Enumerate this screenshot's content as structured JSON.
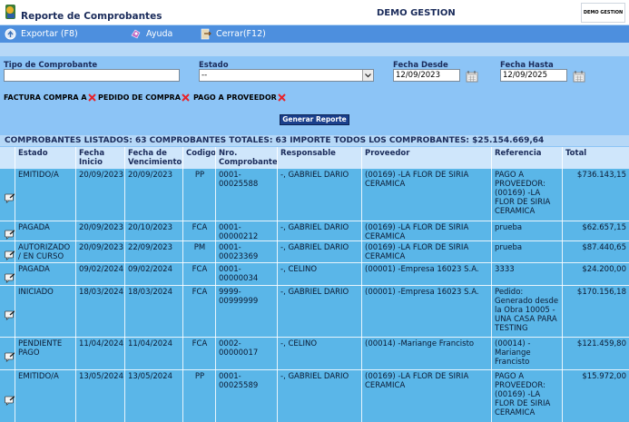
{
  "header": {
    "title": "Reporte de Comprobantes",
    "company": "DEMO GESTION",
    "company_logo_text": "DEMO GESTION"
  },
  "toolbar": {
    "export_label": "Exportar (F8)",
    "help_label": "Ayuda",
    "close_label": "Cerrar(F12)"
  },
  "filters": {
    "tipo_label": "Tipo de Comprobante",
    "tipo_value": "",
    "estado_label": "Estado",
    "estado_value": "--",
    "fecha_desde_label": "Fecha Desde",
    "fecha_desde_value": "12/09/2023",
    "fecha_hasta_label": "Fecha Hasta",
    "fecha_hasta_value": "12/09/2025",
    "chips": [
      "FACTURA COMPRA A",
      "PEDIDO DE COMPRA",
      "PAGO A PROVEEDOR"
    ],
    "generate_label": "Generar Reporte"
  },
  "summary": "COMPROBANTES LISTADOS: 63 COMPROBANTES TOTALES: 63 IMPORTE TODOS LOS COMPROBANTES: $25.154.669,64",
  "table": {
    "headers": [
      "Estado",
      "Fecha Inicio",
      "Fecha de Vencimiento",
      "Codigo",
      "Nro. Comprobante",
      "Responsable",
      "Proveedor",
      "Referencia",
      "Total"
    ],
    "rows": [
      [
        "EMITIDO/A",
        "20/09/2023",
        "20/09/2023",
        "PP",
        "0001-00025588",
        "-, GABRIEL DARIO",
        "(00169) -LA FLOR DE SIRIA CERAMICA",
        "PAGO A PROVEEDOR: (00169) -LA FLOR DE SIRIA CERAMICA",
        "$736.143,15"
      ],
      [
        "PAGADA",
        "20/09/2023",
        "20/10/2023",
        "FCA",
        "0001-00000212",
        "-, GABRIEL DARIO",
        "(00169) -LA FLOR DE SIRIA CERAMICA",
        "prueba",
        "$62.657,15"
      ],
      [
        "AUTORIZADO / EN CURSO",
        "20/09/2023",
        "22/09/2023",
        "PM",
        "0001-00023369",
        "-, GABRIEL DARIO",
        "(00169) -LA FLOR DE SIRIA CERAMICA",
        "prueba",
        "$87.440,65"
      ],
      [
        "PAGADA",
        "09/02/2024",
        "09/02/2024",
        "FCA",
        "0001-00000034",
        "-, CELINO",
        "(00001) -Empresa 16023 S.A.",
        "3333",
        "$24.200,00"
      ],
      [
        "INICIADO",
        "18/03/2024",
        "18/03/2024",
        "FCA",
        "9999-00999999",
        "-, GABRIEL DARIO",
        "(00001) -Empresa 16023 S.A.",
        "Pedido: Generado desde la Obra 10005 - UNA CASA PARA TESTING",
        "$170.156,18"
      ],
      [
        "PENDIENTE PAGO",
        "11/04/2024",
        "11/04/2024",
        "FCA",
        "0002-00000017",
        "-, CELINO",
        "(00014) -Mariange Francisto",
        "(00014) -Mariange Francisto",
        "$121.459,80"
      ],
      [
        "EMITIDO/A",
        "13/05/2024",
        "13/05/2024",
        "PP",
        "0001-00025589",
        "-, GABRIEL DARIO",
        "(00169) -LA FLOR DE SIRIA CERAMICA",
        "PAGO A PROVEEDOR: (00169) -LA FLOR DE SIRIA CERAMICA",
        "$15.972,00"
      ]
    ]
  }
}
